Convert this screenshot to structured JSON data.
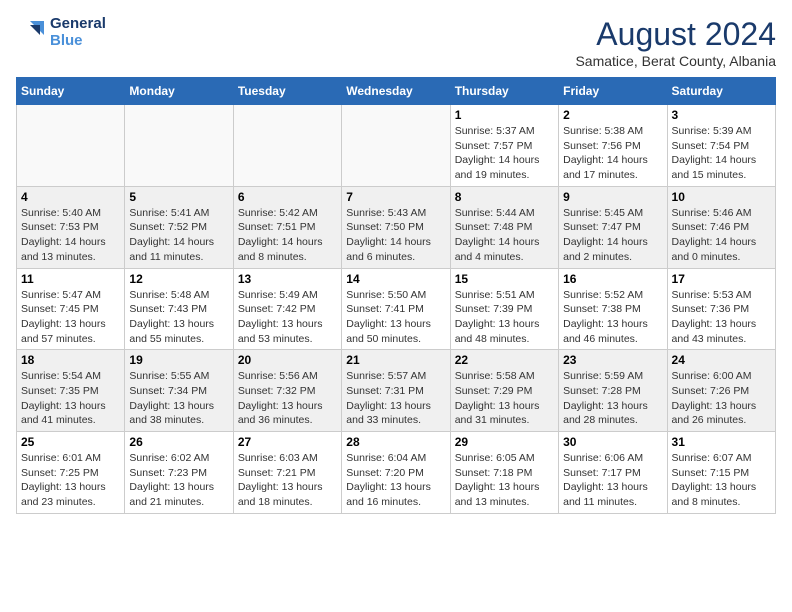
{
  "header": {
    "logo_line1": "General",
    "logo_line2": "Blue",
    "month_year": "August 2024",
    "location": "Samatice, Berat County, Albania"
  },
  "days_of_week": [
    "Sunday",
    "Monday",
    "Tuesday",
    "Wednesday",
    "Thursday",
    "Friday",
    "Saturday"
  ],
  "weeks": [
    [
      {
        "day": "",
        "info": ""
      },
      {
        "day": "",
        "info": ""
      },
      {
        "day": "",
        "info": ""
      },
      {
        "day": "",
        "info": ""
      },
      {
        "day": "1",
        "info": "Sunrise: 5:37 AM\nSunset: 7:57 PM\nDaylight: 14 hours\nand 19 minutes."
      },
      {
        "day": "2",
        "info": "Sunrise: 5:38 AM\nSunset: 7:56 PM\nDaylight: 14 hours\nand 17 minutes."
      },
      {
        "day": "3",
        "info": "Sunrise: 5:39 AM\nSunset: 7:54 PM\nDaylight: 14 hours\nand 15 minutes."
      }
    ],
    [
      {
        "day": "4",
        "info": "Sunrise: 5:40 AM\nSunset: 7:53 PM\nDaylight: 14 hours\nand 13 minutes."
      },
      {
        "day": "5",
        "info": "Sunrise: 5:41 AM\nSunset: 7:52 PM\nDaylight: 14 hours\nand 11 minutes."
      },
      {
        "day": "6",
        "info": "Sunrise: 5:42 AM\nSunset: 7:51 PM\nDaylight: 14 hours\nand 8 minutes."
      },
      {
        "day": "7",
        "info": "Sunrise: 5:43 AM\nSunset: 7:50 PM\nDaylight: 14 hours\nand 6 minutes."
      },
      {
        "day": "8",
        "info": "Sunrise: 5:44 AM\nSunset: 7:48 PM\nDaylight: 14 hours\nand 4 minutes."
      },
      {
        "day": "9",
        "info": "Sunrise: 5:45 AM\nSunset: 7:47 PM\nDaylight: 14 hours\nand 2 minutes."
      },
      {
        "day": "10",
        "info": "Sunrise: 5:46 AM\nSunset: 7:46 PM\nDaylight: 14 hours\nand 0 minutes."
      }
    ],
    [
      {
        "day": "11",
        "info": "Sunrise: 5:47 AM\nSunset: 7:45 PM\nDaylight: 13 hours\nand 57 minutes."
      },
      {
        "day": "12",
        "info": "Sunrise: 5:48 AM\nSunset: 7:43 PM\nDaylight: 13 hours\nand 55 minutes."
      },
      {
        "day": "13",
        "info": "Sunrise: 5:49 AM\nSunset: 7:42 PM\nDaylight: 13 hours\nand 53 minutes."
      },
      {
        "day": "14",
        "info": "Sunrise: 5:50 AM\nSunset: 7:41 PM\nDaylight: 13 hours\nand 50 minutes."
      },
      {
        "day": "15",
        "info": "Sunrise: 5:51 AM\nSunset: 7:39 PM\nDaylight: 13 hours\nand 48 minutes."
      },
      {
        "day": "16",
        "info": "Sunrise: 5:52 AM\nSunset: 7:38 PM\nDaylight: 13 hours\nand 46 minutes."
      },
      {
        "day": "17",
        "info": "Sunrise: 5:53 AM\nSunset: 7:36 PM\nDaylight: 13 hours\nand 43 minutes."
      }
    ],
    [
      {
        "day": "18",
        "info": "Sunrise: 5:54 AM\nSunset: 7:35 PM\nDaylight: 13 hours\nand 41 minutes."
      },
      {
        "day": "19",
        "info": "Sunrise: 5:55 AM\nSunset: 7:34 PM\nDaylight: 13 hours\nand 38 minutes."
      },
      {
        "day": "20",
        "info": "Sunrise: 5:56 AM\nSunset: 7:32 PM\nDaylight: 13 hours\nand 36 minutes."
      },
      {
        "day": "21",
        "info": "Sunrise: 5:57 AM\nSunset: 7:31 PM\nDaylight: 13 hours\nand 33 minutes."
      },
      {
        "day": "22",
        "info": "Sunrise: 5:58 AM\nSunset: 7:29 PM\nDaylight: 13 hours\nand 31 minutes."
      },
      {
        "day": "23",
        "info": "Sunrise: 5:59 AM\nSunset: 7:28 PM\nDaylight: 13 hours\nand 28 minutes."
      },
      {
        "day": "24",
        "info": "Sunrise: 6:00 AM\nSunset: 7:26 PM\nDaylight: 13 hours\nand 26 minutes."
      }
    ],
    [
      {
        "day": "25",
        "info": "Sunrise: 6:01 AM\nSunset: 7:25 PM\nDaylight: 13 hours\nand 23 minutes."
      },
      {
        "day": "26",
        "info": "Sunrise: 6:02 AM\nSunset: 7:23 PM\nDaylight: 13 hours\nand 21 minutes."
      },
      {
        "day": "27",
        "info": "Sunrise: 6:03 AM\nSunset: 7:21 PM\nDaylight: 13 hours\nand 18 minutes."
      },
      {
        "day": "28",
        "info": "Sunrise: 6:04 AM\nSunset: 7:20 PM\nDaylight: 13 hours\nand 16 minutes."
      },
      {
        "day": "29",
        "info": "Sunrise: 6:05 AM\nSunset: 7:18 PM\nDaylight: 13 hours\nand 13 minutes."
      },
      {
        "day": "30",
        "info": "Sunrise: 6:06 AM\nSunset: 7:17 PM\nDaylight: 13 hours\nand 11 minutes."
      },
      {
        "day": "31",
        "info": "Sunrise: 6:07 AM\nSunset: 7:15 PM\nDaylight: 13 hours\nand 8 minutes."
      }
    ]
  ]
}
